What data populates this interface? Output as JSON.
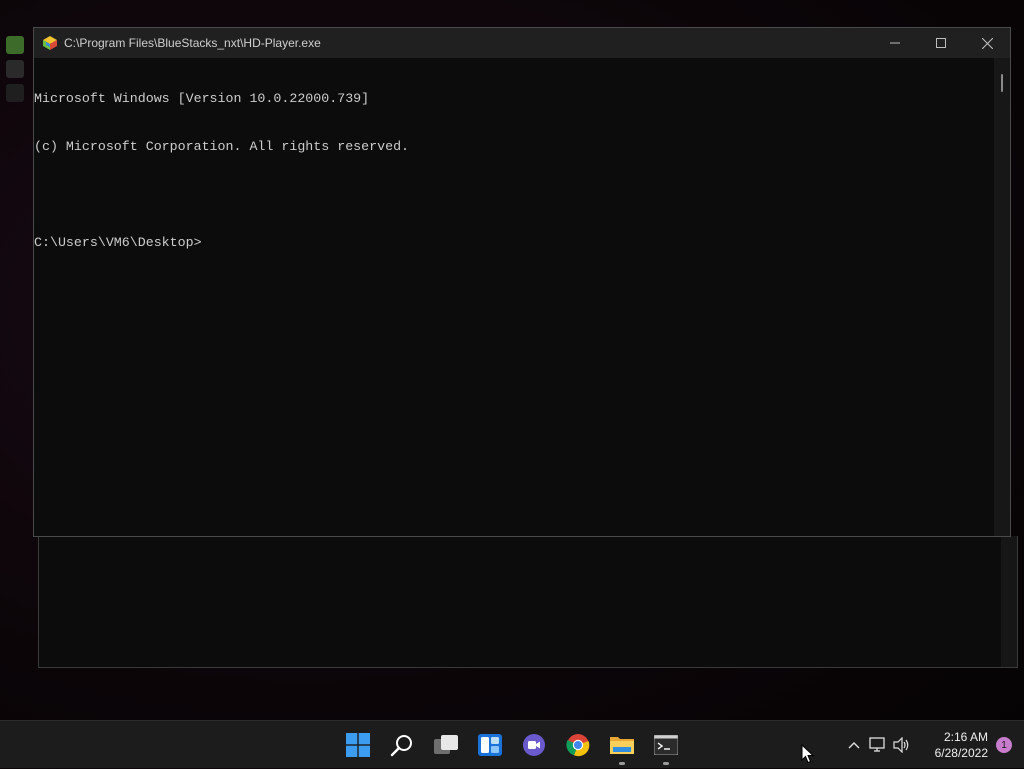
{
  "window": {
    "title": "C:\\Program Files\\BlueStacks_nxt\\HD-Player.exe",
    "controls": {
      "minimize": "minimize-icon",
      "maximize": "maximize-icon",
      "close": "close-icon"
    }
  },
  "console": {
    "lines": [
      "Microsoft Windows [Version 10.0.22000.739]",
      "(c) Microsoft Corporation. All rights reserved.",
      "",
      "C:\\Users\\VM6\\Desktop>"
    ]
  },
  "taskbar": {
    "apps": [
      {
        "name": "start-button",
        "icon": "windows-logo-icon",
        "running": false
      },
      {
        "name": "search-button",
        "icon": "search-icon",
        "running": false
      },
      {
        "name": "task-view-button",
        "icon": "task-view-icon",
        "running": false
      },
      {
        "name": "widgets-button",
        "icon": "widgets-icon",
        "running": false
      },
      {
        "name": "teams-chat-button",
        "icon": "teams-chat-icon",
        "running": false
      },
      {
        "name": "chrome-button",
        "icon": "chrome-icon",
        "running": false
      },
      {
        "name": "file-explorer-button",
        "icon": "folder-icon",
        "running": true
      },
      {
        "name": "command-prompt-button",
        "icon": "terminal-icon",
        "running": true
      }
    ],
    "tray": {
      "icons": [
        "chevron-up-icon",
        "network-icon",
        "volume-icon"
      ],
      "time": "2:16 AM",
      "date": "6/28/2022",
      "notification_count": "1"
    }
  },
  "colors": {
    "console_bg": "#0c0c0c",
    "console_text": "#cccccc",
    "titlebar_bg": "#202020",
    "taskbar_bg": "#1c1c1c",
    "accent_blue": "#3b9cf0",
    "notification_badge": "#c77dcb"
  }
}
